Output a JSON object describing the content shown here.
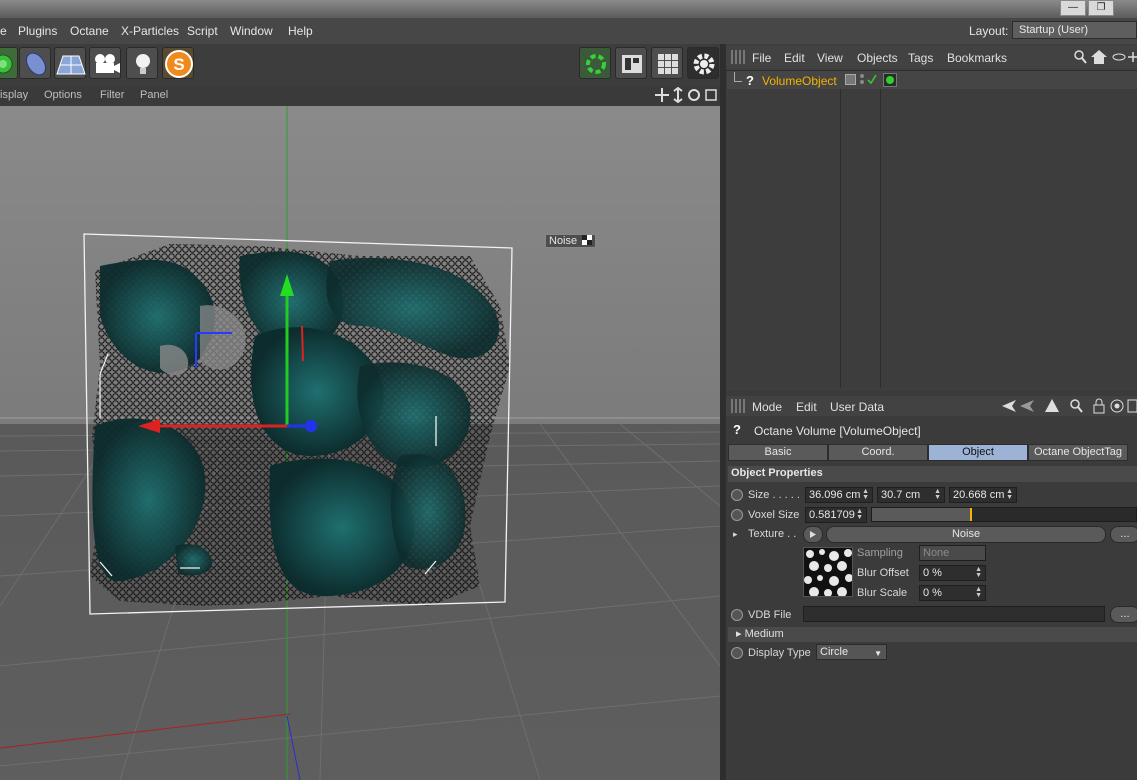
{
  "window": {
    "minimize_glyph": "—",
    "restore_glyph": "❐"
  },
  "menubar": {
    "items": [
      "e",
      "Plugins",
      "Octane",
      "X-Particles",
      "Script",
      "Window",
      "Help"
    ],
    "layout_label": "Layout:",
    "layout_value": "Startup (User)"
  },
  "viewport_menu": {
    "items": [
      "isplay",
      "Options",
      "Filter",
      "Panel"
    ]
  },
  "viewport": {
    "noise_label": "Noise"
  },
  "object_manager": {
    "menu": [
      "File",
      "Edit",
      "View",
      "Objects",
      "Tags",
      "Bookmarks"
    ],
    "object_name": "VolumeObject",
    "object_icon": "?"
  },
  "attribute_manager": {
    "menu": [
      "Mode",
      "Edit",
      "User Data"
    ],
    "title_icon": "?",
    "title": "Octane Volume [VolumeObject]",
    "tabs": [
      "Basic",
      "Coord.",
      "Object",
      "Octane ObjectTag"
    ],
    "active_tab": "Object",
    "section": "Object Properties",
    "size_label": "Size . . . . .",
    "size_x": "36.096 cm",
    "size_y": "30.7 cm",
    "size_z": "20.668 cm",
    "voxel_label": "Voxel Size",
    "voxel_value": "0.581709",
    "voxel_slider_fraction": 0.37,
    "texture_label": "Texture . .",
    "texture_value": "Noise",
    "ellipsis": "...",
    "sampling_label": "Sampling",
    "sampling_value": "None",
    "blur_offset_label": "Blur Offset",
    "blur_offset_value": "0 %",
    "blur_scale_label": "Blur Scale",
    "blur_scale_value": "0 %",
    "vdb_label": "VDB File",
    "medium_label": "Medium",
    "display_type_label": "Display Type",
    "display_type_value": "Circle"
  },
  "colors": {
    "accent_tab": "#9cb3d6",
    "object_name": "#f5b400",
    "volume": "#1d5a5c",
    "axis_y": "#22cc22",
    "axis_x": "#dd2222",
    "axis_z": "#2233ee"
  }
}
